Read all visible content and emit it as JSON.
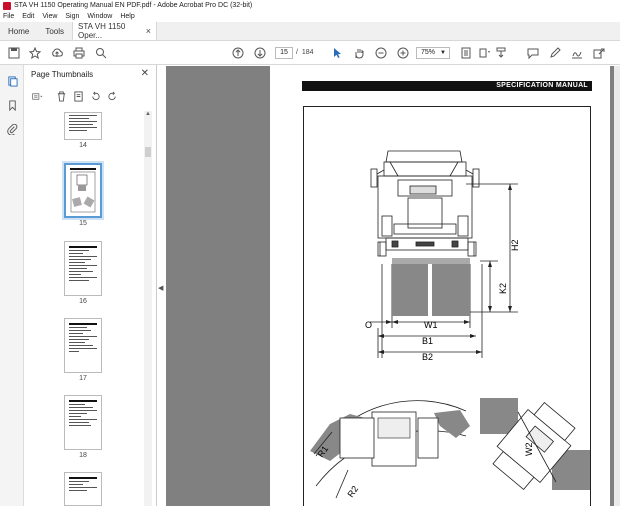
{
  "window": {
    "title": "STA VH 1150 Operating Manual EN PDF.pdf - Adobe Acrobat Pro DC (32-bit)"
  },
  "menu": [
    "File",
    "Edit",
    "View",
    "Sign",
    "Window",
    "Help"
  ],
  "tabs": {
    "home": "Home",
    "tools": "Tools",
    "document": "STA VH 1150 Oper...",
    "close": "×"
  },
  "toolbar": {
    "page_current": "15",
    "page_separator": "/",
    "page_total": "184",
    "zoom": "75%"
  },
  "thumbnails": {
    "header": "Page Thumbnails",
    "close": "✕",
    "pages": [
      {
        "label": "14"
      },
      {
        "label": "15"
      },
      {
        "label": "16"
      },
      {
        "label": "17"
      },
      {
        "label": "18"
      }
    ]
  },
  "document": {
    "header": "SPECIFICATION MANUAL",
    "dims": {
      "w1": "W1",
      "b1": "B1",
      "b2": "B2",
      "h2": "H2",
      "k2": "K2",
      "o": "O",
      "r1": "R1",
      "r2": "R2",
      "w2": "W2"
    }
  },
  "colors": {
    "accent": "#c8102e",
    "selection": "#5b9bd5",
    "doc_background": "#808080"
  }
}
